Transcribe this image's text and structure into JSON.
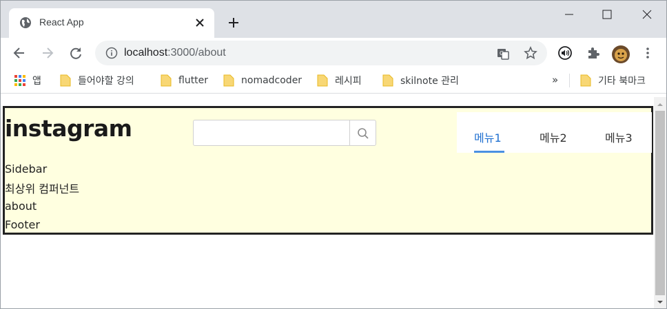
{
  "browser": {
    "tab_title": "React App",
    "url_host": "localhost",
    "url_path": ":3000/about"
  },
  "bookmarks": {
    "apps_label": "앱",
    "items": [
      "들어야할 강의",
      "flutter",
      "nomadcoder",
      "레시피",
      "skilnote 관리"
    ],
    "more": "»",
    "other": "기타 북마크"
  },
  "page": {
    "logo": "instagram",
    "search": {
      "value": "",
      "placeholder": ""
    },
    "menu": [
      {
        "label": "메뉴1",
        "active": true
      },
      {
        "label": "메뉴2",
        "active": false
      },
      {
        "label": "메뉴3",
        "active": false
      }
    ],
    "lines": [
      "Sidebar",
      "최상위 컴퍼넌트",
      "about",
      "Footer"
    ]
  },
  "colors": {
    "app_background": "#ffffe0",
    "app_border": "#222222",
    "menu_active": "#1e6fd0",
    "menu_underline": "#4a90e2"
  }
}
